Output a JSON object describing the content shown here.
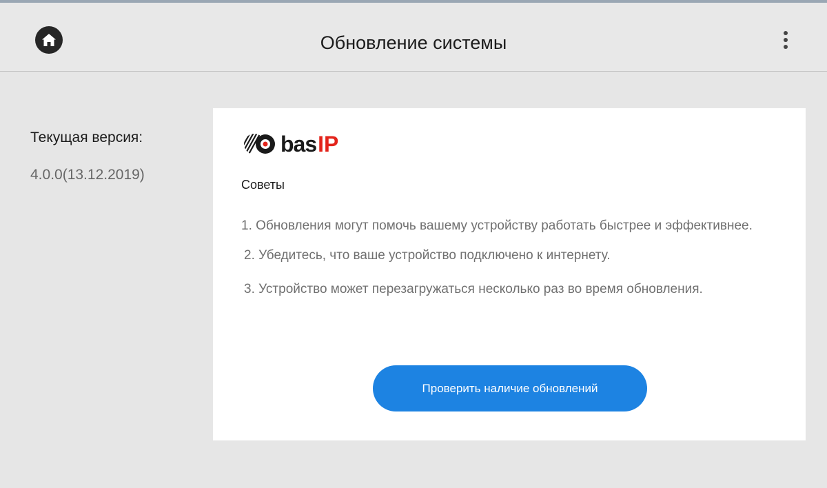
{
  "header": {
    "title": "Обновление системы",
    "home_icon": "home-icon",
    "menu_icon": "more-vertical-icon"
  },
  "version": {
    "label": "Текущая версия:",
    "value": "4.0.0(13.12.2019)"
  },
  "card": {
    "logo": {
      "bas": "bas",
      "ip": "IP",
      "ip_color": "#e3241b"
    },
    "tips_title": "Советы",
    "tips": [
      "1. Обновления могут помочь вашему устройству работать быстрее и эффективнее.",
      "2. Убедитесь, что ваше устройство подключено к интернету.",
      "3. Устройство может перезагружаться несколько раз во время обновления."
    ],
    "check_button": "Проверить наличие обновлений"
  },
  "colors": {
    "background": "#e6e6e6",
    "card": "#ffffff",
    "accent": "#1d83e2"
  }
}
